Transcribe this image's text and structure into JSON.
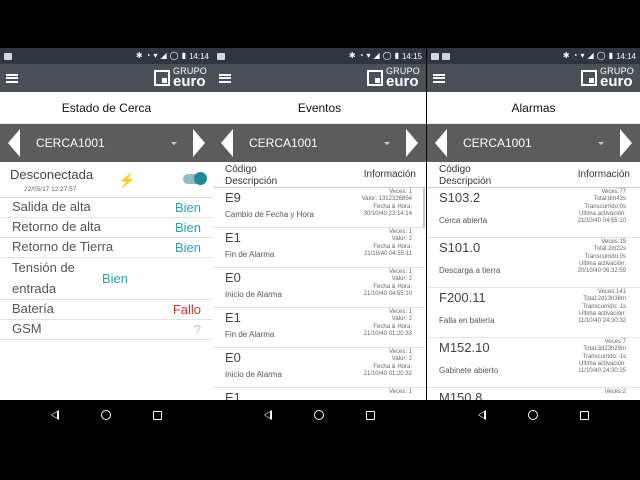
{
  "status_bar": {
    "times": [
      "14:14",
      "14:15",
      "14:14"
    ]
  },
  "logo": {
    "top": "GRUPO",
    "bottom": "euro"
  },
  "selector": {
    "value": "CERCA1001"
  },
  "screen1": {
    "title": "Estado de Cerca",
    "status": {
      "label": "Desconectada",
      "date": "22/05/17 12:27:57"
    },
    "rows": [
      {
        "label": "Salida de alta",
        "value": "Bien",
        "kind": "ok"
      },
      {
        "label": "Retorno de alta",
        "value": "Bien",
        "kind": "ok"
      },
      {
        "label": "Retorno de Tierra",
        "value": "Bien",
        "kind": "ok"
      },
      {
        "label": "Tensión de entrada",
        "value": "Bien",
        "kind": "ok"
      },
      {
        "label": "Batería",
        "value": "Fallo",
        "kind": "bad"
      },
      {
        "label": "GSM",
        "value": "?",
        "kind": "unk"
      }
    ]
  },
  "screen2": {
    "title": "Eventos",
    "header": {
      "col1_line1": "Código",
      "col1_line2": "Descripción",
      "col2": "Información"
    },
    "items": [
      {
        "code": "E9",
        "desc": "Cambio de Fecha y Hora",
        "info": [
          "Veces: 1",
          "Valor: 1312326854",
          "Fecha & Hora:",
          "30/10/40 23:14:14"
        ]
      },
      {
        "code": "E1",
        "desc": "Fin de Alarma",
        "info": [
          "Veces: 1",
          "Valor: 2",
          "Fecha & Hora:",
          "21/10/40 04:55:11"
        ]
      },
      {
        "code": "E0",
        "desc": "Inicio de Alarma",
        "info": [
          "Veces: 1",
          "Valor: 2",
          "Fecha & Hora:",
          "21/10/40 04:55:10"
        ]
      },
      {
        "code": "E1",
        "desc": "Fin de Alarma",
        "info": [
          "Veces: 1",
          "Valor: 2",
          "Fecha & Hora:",
          "21/10/40 01:20:33"
        ]
      },
      {
        "code": "E0",
        "desc": "Inicio de Alarma",
        "info": [
          "Veces: 1",
          "Valor: 2",
          "Fecha & Hora:",
          "21/10/40 01:20:32"
        ]
      },
      {
        "code": "E1",
        "desc": "",
        "info": [
          "Veces: 1"
        ]
      }
    ]
  },
  "screen3": {
    "title": "Alarmas",
    "header": {
      "col1_line1": "Código",
      "col1_line2": "Descripción",
      "col2": "Información"
    },
    "items": [
      {
        "code": "S103.2",
        "desc": "Cerca abierta",
        "info": [
          "Veces:77",
          "Total:8m43s",
          "Transcurrido:0s",
          "Ultima activación:",
          "21/10/40 04:55:10"
        ]
      },
      {
        "code": "S101.0",
        "desc": "Descarga a tierra",
        "info": [
          "Veces:19",
          "Total:2m22s",
          "Transcurrido:0s",
          "Ultima activación:",
          "20/10/40 06:32:59"
        ]
      },
      {
        "code": "F200.11",
        "desc": "Falla en batería",
        "info": [
          "Veces:141",
          "Total:2d13h38m",
          "Transcurrido:-1s",
          "Ultima activación:",
          "11/10/40 24:30:32"
        ]
      },
      {
        "code": "M152.10",
        "desc": "Gabinete abierto",
        "info": [
          "Veces:7",
          "Total:3d23h29m",
          "Transcurrido:-1s",
          "Ultima activación:",
          "11/10/40 24:30:25"
        ]
      },
      {
        "code": "M150.8",
        "desc": "",
        "info": [
          "Veces:2"
        ]
      }
    ]
  }
}
